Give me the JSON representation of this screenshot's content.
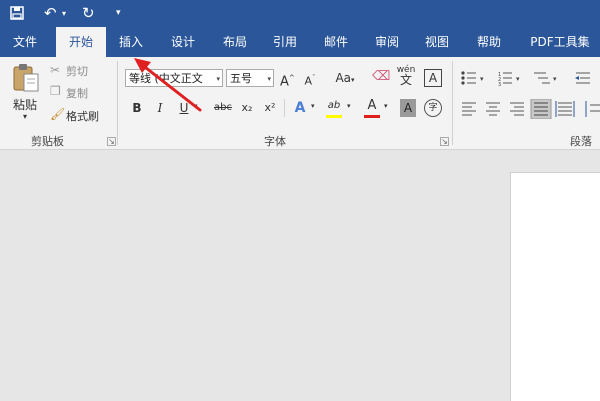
{
  "qat": {
    "save_icon": "save-icon",
    "undo_icon": "undo-icon",
    "redo_icon": "redo-icon"
  },
  "tabs": [
    "文件",
    "开始",
    "插入",
    "设计",
    "布局",
    "引用",
    "邮件",
    "审阅",
    "视图",
    "帮助",
    "PDF工具集"
  ],
  "active_tab": "开始",
  "clipboard": {
    "paste": "粘贴",
    "cut": "剪切",
    "copy": "复制",
    "format_painter": "格式刷",
    "group_label": "剪贴板"
  },
  "font": {
    "font_name": "等线 (中文正文",
    "font_size": "五号",
    "grow": "A",
    "shrink": "A",
    "case": "Aa",
    "phonetic_top": "wén",
    "phonetic_bottom": "文",
    "border_char": "A",
    "bold": "B",
    "italic": "I",
    "underline": "U",
    "strike": "abc",
    "subscript": "x₂",
    "superscript": "x²",
    "text_effect": "A",
    "highlight": "ab",
    "font_color": "A",
    "char_shade": "A",
    "enclose": "字",
    "group_label": "字体"
  },
  "paragraph": {
    "group_label": "段落"
  },
  "colors": {
    "accent": "#2b579a",
    "highlight_bar": "#ffff00",
    "font_color_bar": "#e0201b",
    "arrow": "#e02020"
  }
}
